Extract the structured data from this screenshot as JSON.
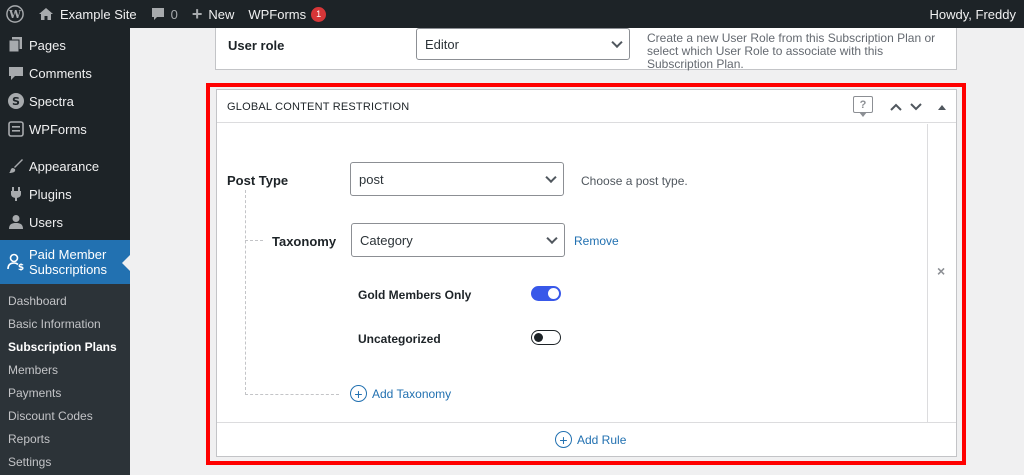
{
  "adminbar": {
    "site_name": "Example Site",
    "comments_count": "0",
    "new_label": "New",
    "wpforms_label": "WPForms",
    "wpforms_badge": "1",
    "greeting": "Howdy, Freddy"
  },
  "sidebar": {
    "items": [
      {
        "label": "Pages",
        "icon": "pages-icon"
      },
      {
        "label": "Comments",
        "icon": "comments-icon"
      },
      {
        "label": "Spectra",
        "icon": "spectra-icon"
      },
      {
        "label": "WPForms",
        "icon": "wpforms-icon"
      },
      {
        "label": "Appearance",
        "icon": "appearance-icon"
      },
      {
        "label": "Plugins",
        "icon": "plugins-icon"
      },
      {
        "label": "Users",
        "icon": "users-icon"
      }
    ],
    "current": {
      "label_line1": "Paid Member",
      "label_line2": "Subscriptions"
    },
    "submenu": [
      "Dashboard",
      "Basic Information",
      "Subscription Plans",
      "Members",
      "Payments",
      "Discount Codes",
      "Reports",
      "Settings"
    ],
    "submenu_current": "Subscription Plans"
  },
  "user_role": {
    "label": "User role",
    "selected": "Editor",
    "description": "Create a new User Role from this Subscription Plan or select which User Role to associate with this Subscription Plan."
  },
  "restriction": {
    "title": "GLOBAL CONTENT RESTRICTION",
    "help_glyph": "?",
    "post_type_label": "Post Type",
    "post_type_value": "post",
    "post_type_hint": "Choose a post type.",
    "taxonomy_label": "Taxonomy",
    "taxonomy_value": "Category",
    "remove_label": "Remove",
    "terms": [
      {
        "label": "Gold Members Only",
        "enabled": true
      },
      {
        "label": "Uncategorized",
        "enabled": false
      }
    ],
    "add_taxonomy_label": "Add Taxonomy",
    "add_rule_label": "Add Rule",
    "remove_rule_glyph": "×"
  },
  "colors": {
    "admin_dark": "#1d2327",
    "accent_blue": "#2271b1",
    "toggle_on": "#3858e9",
    "highlight_red": "#ff0000"
  }
}
